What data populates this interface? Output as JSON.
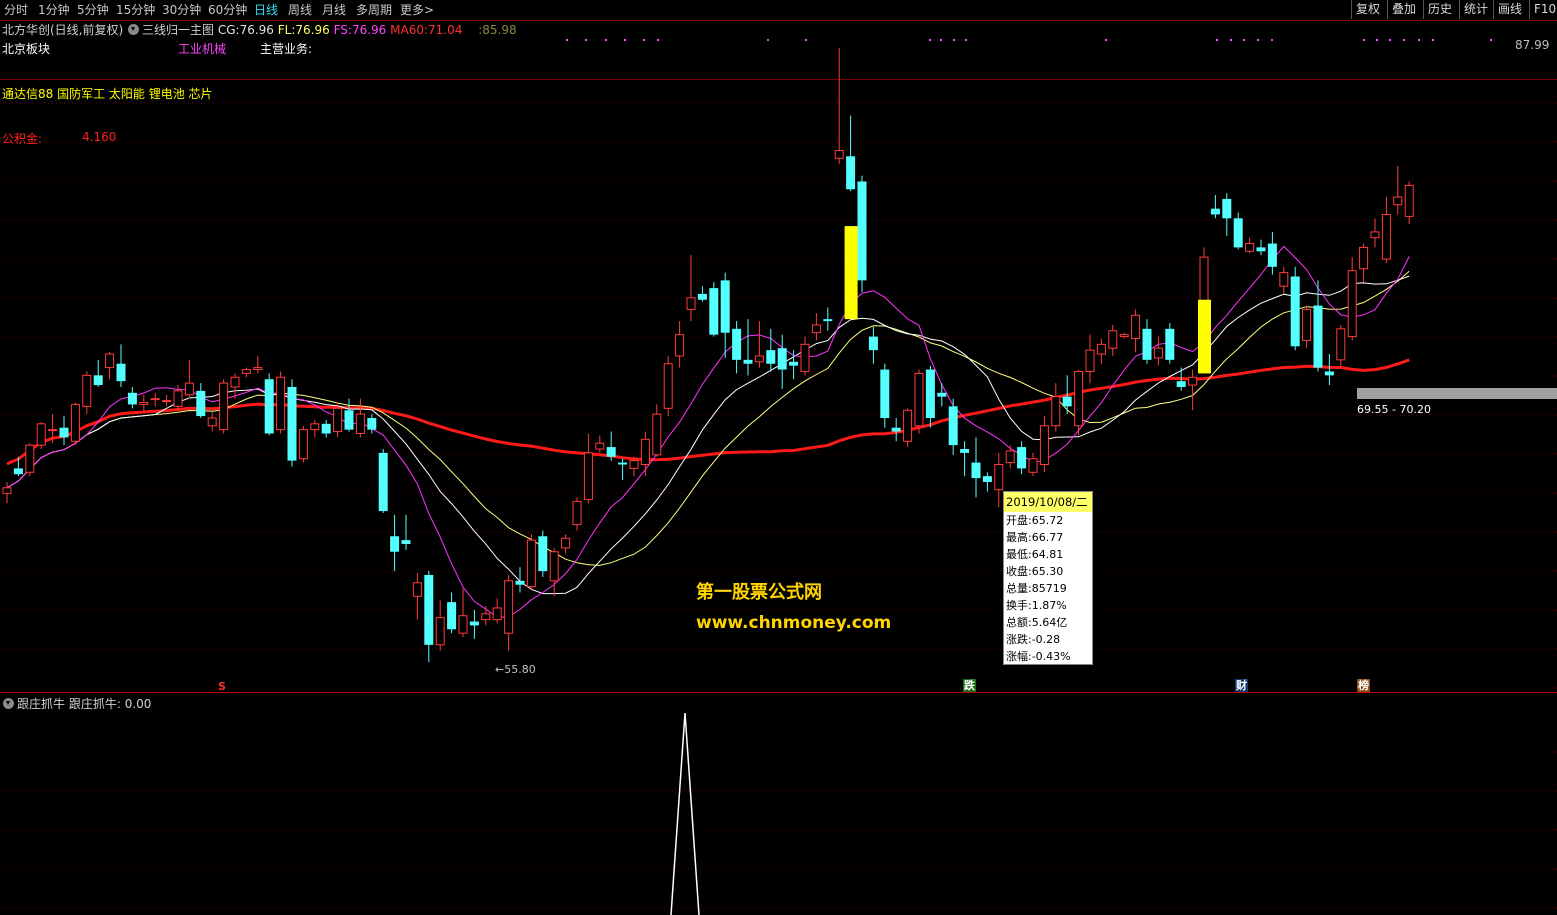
{
  "timeframes": [
    "分时",
    "1分钟",
    "5分钟",
    "15分钟",
    "30分钟",
    "60分钟",
    "日线",
    "周线",
    "月线",
    "多周期",
    "更多>"
  ],
  "timeframe_active": "日线",
  "right_buttons": [
    "复权",
    "叠加",
    "历史",
    "统计",
    "画线",
    "F10"
  ],
  "stock": {
    "title": "北方华创(日线,前复权)",
    "block": "北京板块",
    "industry": "工业机械",
    "business_label": "主营业务:"
  },
  "indicator": {
    "name": "三线归一主图",
    "cg_label": "CG:",
    "cg_value": "76.96",
    "fl_label": "FL:",
    "fl_value": "76.96",
    "fs_label": "FS:",
    "fs_value": "76.96",
    "ma60_label": "MA60:",
    "ma60_value": "71.04",
    "extra_label": ":",
    "extra_value": "85.98"
  },
  "concepts": "通达信88 国防军工 太阳能 锂电池 芯片",
  "fund": {
    "label": "公积金:",
    "value": "4.160"
  },
  "price_axis": {
    "top_label": "87.99",
    "low_label": "←55.80",
    "range_label": "69.55 - 70.20"
  },
  "markers": {
    "s": "S",
    "die": "跌",
    "cai": "财",
    "bang": "榜"
  },
  "tooltip": {
    "date": "2019/10/08/二",
    "rows": [
      "开盘:65.72",
      "最高:66.77",
      "最低:64.81",
      "收盘:65.30",
      "总量:85719",
      "换手:1.87%",
      "总额:5.64亿",
      "涨跌:-0.28",
      "涨幅:-0.43%"
    ]
  },
  "watermark": {
    "line1": "第一股票公式网",
    "line2": "www.chnmoney.com"
  },
  "sub_indicator": {
    "name": "跟庄抓牛",
    "label": "跟庄抓牛:",
    "value": "0.00"
  },
  "colors": {
    "up": "#ff3b3b",
    "down": "#54ffff",
    "ma60": "#ff1a1a",
    "cg": "#ffff80",
    "fl": "#ffffff",
    "fs": "#ff33ff",
    "signal": "#ffff00"
  },
  "chart_data": {
    "type": "candlestick",
    "y_range": [
      55.8,
      87.99
    ],
    "candles": [
      {
        "o": 64.9,
        "h": 65.5,
        "l": 64.4,
        "c": 65.2
      },
      {
        "o": 66.2,
        "h": 66.8,
        "l": 65.8,
        "c": 65.9
      },
      {
        "o": 66.0,
        "h": 67.5,
        "l": 65.8,
        "c": 67.4
      },
      {
        "o": 67.4,
        "h": 68.6,
        "l": 67.2,
        "c": 68.5
      },
      {
        "o": 68.2,
        "h": 69.0,
        "l": 67.5,
        "c": 68.2
      },
      {
        "o": 68.3,
        "h": 68.9,
        "l": 67.4,
        "c": 67.8
      },
      {
        "o": 67.6,
        "h": 69.6,
        "l": 67.4,
        "c": 69.5
      },
      {
        "o": 69.4,
        "h": 71.2,
        "l": 69.0,
        "c": 71.0
      },
      {
        "o": 71.0,
        "h": 71.8,
        "l": 70.4,
        "c": 70.5
      },
      {
        "o": 71.4,
        "h": 72.2,
        "l": 70.8,
        "c": 72.1
      },
      {
        "o": 71.6,
        "h": 72.6,
        "l": 70.4,
        "c": 70.7
      },
      {
        "o": 70.1,
        "h": 70.4,
        "l": 69.3,
        "c": 69.5
      },
      {
        "o": 69.5,
        "h": 70.0,
        "l": 69.1,
        "c": 69.6
      },
      {
        "o": 69.8,
        "h": 70.1,
        "l": 69.4,
        "c": 69.8
      },
      {
        "o": 69.7,
        "h": 70.0,
        "l": 69.4,
        "c": 69.7
      },
      {
        "o": 69.4,
        "h": 70.5,
        "l": 69.2,
        "c": 70.2
      },
      {
        "o": 70.0,
        "h": 71.8,
        "l": 69.8,
        "c": 70.6
      },
      {
        "o": 70.2,
        "h": 70.6,
        "l": 68.8,
        "c": 68.9
      },
      {
        "o": 68.4,
        "h": 69.1,
        "l": 68.1,
        "c": 68.8
      },
      {
        "o": 68.2,
        "h": 70.8,
        "l": 68.0,
        "c": 70.6
      },
      {
        "o": 70.4,
        "h": 71.1,
        "l": 69.8,
        "c": 70.9
      },
      {
        "o": 71.1,
        "h": 71.4,
        "l": 70.9,
        "c": 71.3
      },
      {
        "o": 71.3,
        "h": 72.0,
        "l": 71.1,
        "c": 71.4
      },
      {
        "o": 70.8,
        "h": 71.1,
        "l": 67.9,
        "c": 68.0
      },
      {
        "o": 68.2,
        "h": 71.2,
        "l": 68.0,
        "c": 70.9
      },
      {
        "o": 70.4,
        "h": 70.8,
        "l": 66.3,
        "c": 66.6
      },
      {
        "o": 66.7,
        "h": 68.4,
        "l": 66.5,
        "c": 68.2
      },
      {
        "o": 68.2,
        "h": 68.7,
        "l": 67.8,
        "c": 68.5
      },
      {
        "o": 68.5,
        "h": 68.7,
        "l": 67.8,
        "c": 68.0
      },
      {
        "o": 68.1,
        "h": 69.6,
        "l": 67.8,
        "c": 69.3
      },
      {
        "o": 69.2,
        "h": 69.8,
        "l": 68.1,
        "c": 68.2
      },
      {
        "o": 68.0,
        "h": 69.8,
        "l": 67.8,
        "c": 69.0
      },
      {
        "o": 68.8,
        "h": 69.0,
        "l": 68.0,
        "c": 68.2
      },
      {
        "o": 67.0,
        "h": 67.2,
        "l": 63.9,
        "c": 64.0
      },
      {
        "o": 62.7,
        "h": 63.8,
        "l": 60.9,
        "c": 61.9
      },
      {
        "o": 62.5,
        "h": 63.8,
        "l": 62.0,
        "c": 62.3
      },
      {
        "o": 59.6,
        "h": 60.8,
        "l": 58.4,
        "c": 60.3
      },
      {
        "o": 60.7,
        "h": 60.9,
        "l": 56.2,
        "c": 57.1
      },
      {
        "o": 57.1,
        "h": 59.4,
        "l": 56.8,
        "c": 58.5
      },
      {
        "o": 59.3,
        "h": 59.8,
        "l": 57.7,
        "c": 57.9
      },
      {
        "o": 57.7,
        "h": 60.0,
        "l": 57.5,
        "c": 58.6
      },
      {
        "o": 58.3,
        "h": 58.9,
        "l": 57.4,
        "c": 58.1
      },
      {
        "o": 58.4,
        "h": 59.1,
        "l": 58.1,
        "c": 58.7
      },
      {
        "o": 58.4,
        "h": 59.5,
        "l": 58.2,
        "c": 59.0
      },
      {
        "o": 57.7,
        "h": 60.7,
        "l": 56.8,
        "c": 60.4
      },
      {
        "o": 60.4,
        "h": 61.1,
        "l": 59.8,
        "c": 60.2
      },
      {
        "o": 60.1,
        "h": 62.8,
        "l": 59.9,
        "c": 62.5
      },
      {
        "o": 62.7,
        "h": 63.0,
        "l": 60.6,
        "c": 60.9
      },
      {
        "o": 60.4,
        "h": 62.1,
        "l": 59.6,
        "c": 61.9
      },
      {
        "o": 62.1,
        "h": 62.8,
        "l": 61.8,
        "c": 62.6
      },
      {
        "o": 63.3,
        "h": 64.7,
        "l": 63.0,
        "c": 64.5
      },
      {
        "o": 64.6,
        "h": 68.0,
        "l": 64.4,
        "c": 67.0
      },
      {
        "o": 67.2,
        "h": 67.9,
        "l": 67.0,
        "c": 67.5
      },
      {
        "o": 67.3,
        "h": 68.1,
        "l": 66.6,
        "c": 66.8
      },
      {
        "o": 66.5,
        "h": 66.7,
        "l": 65.6,
        "c": 66.4
      },
      {
        "o": 66.2,
        "h": 66.8,
        "l": 65.8,
        "c": 66.6
      },
      {
        "o": 66.4,
        "h": 68.1,
        "l": 65.8,
        "c": 67.7
      },
      {
        "o": 66.9,
        "h": 69.5,
        "l": 66.8,
        "c": 69.0
      },
      {
        "o": 69.3,
        "h": 72.0,
        "l": 68.9,
        "c": 71.6
      },
      {
        "o": 72.0,
        "h": 73.8,
        "l": 71.4,
        "c": 73.1
      },
      {
        "o": 74.4,
        "h": 77.2,
        "l": 73.8,
        "c": 75.0
      },
      {
        "o": 75.2,
        "h": 75.6,
        "l": 74.8,
        "c": 74.9
      },
      {
        "o": 75.5,
        "h": 75.8,
        "l": 73.0,
        "c": 73.1
      },
      {
        "o": 75.9,
        "h": 76.3,
        "l": 71.9,
        "c": 73.2
      },
      {
        "o": 73.4,
        "h": 73.8,
        "l": 71.1,
        "c": 71.8
      },
      {
        "o": 71.8,
        "h": 73.9,
        "l": 71.0,
        "c": 71.6
      },
      {
        "o": 71.7,
        "h": 73.8,
        "l": 71.4,
        "c": 72.0
      },
      {
        "o": 72.3,
        "h": 73.4,
        "l": 71.2,
        "c": 71.6
      },
      {
        "o": 72.4,
        "h": 73.1,
        "l": 70.3,
        "c": 71.3
      },
      {
        "o": 71.7,
        "h": 72.3,
        "l": 70.8,
        "c": 71.5
      },
      {
        "o": 71.2,
        "h": 73.0,
        "l": 71.0,
        "c": 72.6
      },
      {
        "o": 73.2,
        "h": 74.2,
        "l": 72.8,
        "c": 73.6
      },
      {
        "o": 73.9,
        "h": 74.5,
        "l": 73.3,
        "c": 73.8
      },
      {
        "o": 82.2,
        "h": 87.9,
        "l": 81.9,
        "c": 82.6
      },
      {
        "o": 82.3,
        "h": 84.4,
        "l": 80.5,
        "c": 80.6
      },
      {
        "o": 81.0,
        "h": 81.3,
        "l": 75.3,
        "c": 75.9
      },
      {
        "o": 73.0,
        "h": 73.5,
        "l": 71.6,
        "c": 72.3
      },
      {
        "o": 71.3,
        "h": 71.6,
        "l": 68.3,
        "c": 68.8
      },
      {
        "o": 68.3,
        "h": 68.8,
        "l": 67.6,
        "c": 68.1
      },
      {
        "o": 67.6,
        "h": 69.3,
        "l": 67.3,
        "c": 69.2
      },
      {
        "o": 68.4,
        "h": 71.3,
        "l": 68.0,
        "c": 71.1
      },
      {
        "o": 71.3,
        "h": 71.5,
        "l": 68.3,
        "c": 68.8
      },
      {
        "o": 70.1,
        "h": 70.6,
        "l": 69.4,
        "c": 69.9
      },
      {
        "o": 69.4,
        "h": 69.8,
        "l": 66.9,
        "c": 67.4
      },
      {
        "o": 67.2,
        "h": 67.6,
        "l": 65.8,
        "c": 67.0
      },
      {
        "o": 66.5,
        "h": 67.8,
        "l": 64.7,
        "c": 65.7
      },
      {
        "o": 65.8,
        "h": 66.0,
        "l": 65.0,
        "c": 65.5
      },
      {
        "o": 65.1,
        "h": 67.0,
        "l": 64.2,
        "c": 66.4
      },
      {
        "o": 66.5,
        "h": 67.4,
        "l": 66.2,
        "c": 67.1
      },
      {
        "o": 67.3,
        "h": 67.6,
        "l": 65.9,
        "c": 66.2
      },
      {
        "o": 66.0,
        "h": 67.0,
        "l": 65.8,
        "c": 66.7
      },
      {
        "o": 66.4,
        "h": 68.9,
        "l": 66.0,
        "c": 68.4
      },
      {
        "o": 68.4,
        "h": 70.6,
        "l": 68.1,
        "c": 69.9
      },
      {
        "o": 69.9,
        "h": 71.0,
        "l": 69.0,
        "c": 69.4
      },
      {
        "o": 68.4,
        "h": 71.3,
        "l": 67.9,
        "c": 71.2
      },
      {
        "o": 71.2,
        "h": 73.1,
        "l": 70.6,
        "c": 72.3
      },
      {
        "o": 72.1,
        "h": 72.9,
        "l": 71.6,
        "c": 72.6
      },
      {
        "o": 72.4,
        "h": 73.6,
        "l": 72.0,
        "c": 73.3
      },
      {
        "o": 73.0,
        "h": 73.2,
        "l": 72.9,
        "c": 73.1
      },
      {
        "o": 72.9,
        "h": 74.4,
        "l": 72.2,
        "c": 74.1
      },
      {
        "o": 73.4,
        "h": 73.9,
        "l": 71.6,
        "c": 71.8
      },
      {
        "o": 71.9,
        "h": 73.0,
        "l": 71.5,
        "c": 72.4
      },
      {
        "o": 73.4,
        "h": 73.7,
        "l": 71.6,
        "c": 71.8
      },
      {
        "o": 70.7,
        "h": 71.4,
        "l": 70.2,
        "c": 70.4
      },
      {
        "o": 70.5,
        "h": 71.3,
        "l": 69.2,
        "c": 70.9
      },
      {
        "o": 74.0,
        "h": 77.6,
        "l": 73.5,
        "c": 77.1
      },
      {
        "o": 79.6,
        "h": 80.3,
        "l": 79.1,
        "c": 79.3
      },
      {
        "o": 80.1,
        "h": 80.4,
        "l": 78.2,
        "c": 79.1
      },
      {
        "o": 79.1,
        "h": 79.4,
        "l": 77.5,
        "c": 77.6
      },
      {
        "o": 77.4,
        "h": 78.1,
        "l": 77.3,
        "c": 77.8
      },
      {
        "o": 77.6,
        "h": 78.0,
        "l": 77.2,
        "c": 77.4
      },
      {
        "o": 77.8,
        "h": 78.4,
        "l": 76.2,
        "c": 76.6
      },
      {
        "o": 75.6,
        "h": 76.6,
        "l": 75.2,
        "c": 76.3
      },
      {
        "o": 76.1,
        "h": 76.6,
        "l": 72.3,
        "c": 72.5
      },
      {
        "o": 72.8,
        "h": 74.6,
        "l": 72.4,
        "c": 74.4
      },
      {
        "o": 74.6,
        "h": 75.9,
        "l": 71.2,
        "c": 71.4
      },
      {
        "o": 71.2,
        "h": 72.1,
        "l": 70.5,
        "c": 71.0
      },
      {
        "o": 71.8,
        "h": 73.6,
        "l": 71.4,
        "c": 73.4
      },
      {
        "o": 73.0,
        "h": 77.1,
        "l": 72.8,
        "c": 76.4
      },
      {
        "o": 76.5,
        "h": 77.8,
        "l": 75.8,
        "c": 77.6
      },
      {
        "o": 78.1,
        "h": 79.1,
        "l": 77.6,
        "c": 78.4
      },
      {
        "o": 77.0,
        "h": 80.2,
        "l": 76.8,
        "c": 79.3
      },
      {
        "o": 79.8,
        "h": 81.8,
        "l": 79.3,
        "c": 80.2
      },
      {
        "o": 79.2,
        "h": 81.0,
        "l": 78.8,
        "c": 80.8
      }
    ],
    "signal_bars": [
      {
        "index": 74,
        "top": 78.7,
        "bottom": 73.9
      },
      {
        "index": 105,
        "top": 74.9,
        "bottom": 71.1
      }
    ],
    "sub_panel": {
      "type": "line",
      "peak_index": 52,
      "peak_value": 1,
      "base_value": 0
    }
  }
}
